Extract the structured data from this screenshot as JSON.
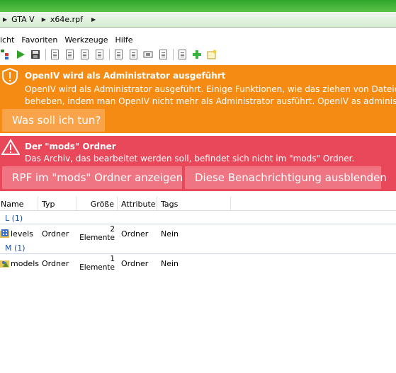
{
  "breadcrumb": {
    "items": [
      "GTA V",
      "x64e.rpf"
    ]
  },
  "menu": {
    "items": [
      "icht",
      "Favoriten",
      "Werkzeuge",
      "Hilfe"
    ]
  },
  "toolbar": {
    "icons": [
      "tree-icon",
      "play-icon",
      "save-icon",
      "edit-icon",
      "search-doc-icon",
      "text-doc-icon",
      "texture-icon",
      "import-icon",
      "export-icon",
      "replace-icon",
      "rebuild-icon",
      "new-doc-icon",
      "add-icon",
      "new-folder-icon"
    ]
  },
  "admin_notice": {
    "title": "OpenIV wird als Administrator ausgeführt",
    "lines": [
      "OpenIV wird als Administrator ausgeführt. Einige Funktionen, wie das ziehen von Dateien a",
      "beheben, indem man OpenIV nicht mehr als Administrator ausführt. OpenIV as administrat"
    ],
    "button": "Was soll ich tun?",
    "color": "#f68b14"
  },
  "mods_notice": {
    "title": "Der \"mods\" Ordner",
    "text": "Das Archiv, das bearbeitet werden soll, befindet sich nicht im \"mods\" Ordner.",
    "button_show": "RPF im \"mods\" Ordner anzeigen",
    "button_hide": "Diese Benachrichtigung ausblenden",
    "color": "#e9475a"
  },
  "list": {
    "columns": [
      "Name",
      "Typ",
      "Größe",
      "Attribute",
      "Tags"
    ],
    "groups": [
      {
        "label": "L (1)",
        "row": {
          "name": "levels",
          "type": "Ordner",
          "size": "2 Elemente",
          "attr": "Ordner",
          "tags": "Nein"
        }
      },
      {
        "label": "M (1)",
        "row": {
          "name": "models",
          "type": "Ordner",
          "size": "1 Elemente",
          "attr": "Ordner",
          "tags": "Nein"
        }
      }
    ]
  }
}
